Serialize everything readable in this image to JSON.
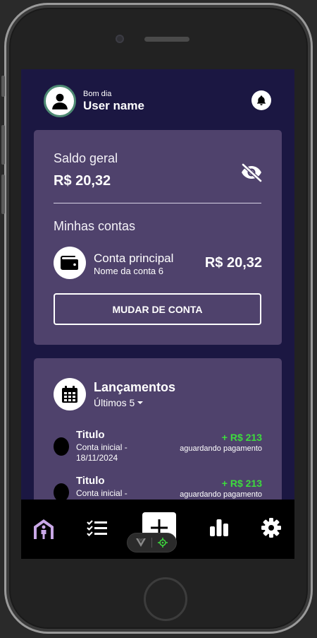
{
  "header": {
    "greeting": "Bom dia",
    "user_name": "User name"
  },
  "balance_card": {
    "label": "Saldo geral",
    "amount": "R$ 20,32",
    "accounts_label": "Minhas contas",
    "account": {
      "name": "Conta principal",
      "subtitle": "Nome da conta 6",
      "amount": "R$ 20,32"
    },
    "change_button": "MUDAR DE CONTA"
  },
  "launches_card": {
    "title": "Lançamentos",
    "filter": "Últimos 5",
    "items": [
      {
        "title": "Titulo",
        "desc": "Conta inicial - 18/11/2024",
        "value": "+ R$ 213",
        "status": "aguardando pagamento"
      },
      {
        "title": "Titulo",
        "desc": "Conta inicial -",
        "value": "+ R$ 213",
        "status": "aguardando pagamento"
      }
    ]
  },
  "colors": {
    "screen_bg": "#1b1742",
    "card_bg": "#4f426c",
    "positive": "#3ddc3d",
    "nav_bg": "#000000",
    "home_active": "#c9a8e6"
  },
  "icons": {
    "nav": [
      "home-person-icon",
      "checklist-icon",
      "plus-icon",
      "bar-chart-icon",
      "gear-icon"
    ]
  }
}
